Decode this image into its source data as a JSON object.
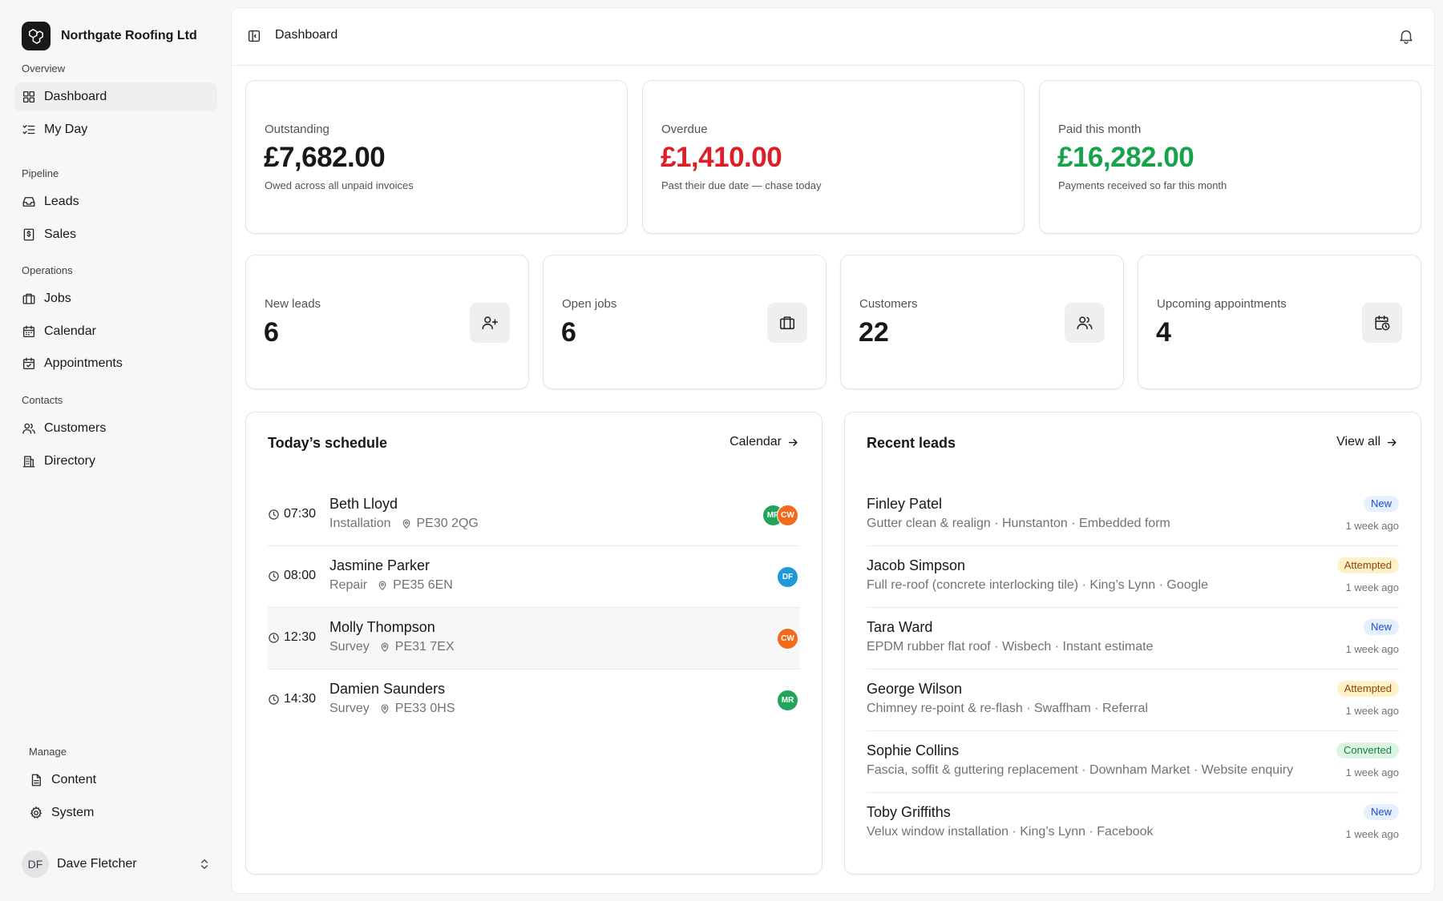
{
  "brand": {
    "name": "Northgate Roofing Ltd"
  },
  "sidebar": {
    "sections": [
      {
        "heading": "Overview",
        "items": [
          {
            "label": "Dashboard",
            "icon": "grid-icon"
          },
          {
            "label": "My Day",
            "icon": "list-check-icon"
          }
        ]
      },
      {
        "heading": "Pipeline",
        "items": [
          {
            "label": "Leads",
            "icon": "inbox-icon"
          },
          {
            "label": "Sales",
            "icon": "receipt-icon"
          }
        ]
      },
      {
        "heading": "Operations",
        "items": [
          {
            "label": "Jobs",
            "icon": "briefcase-icon"
          },
          {
            "label": "Calendar",
            "icon": "calendar-icon"
          },
          {
            "label": "Appointments",
            "icon": "calendar-check-icon"
          }
        ]
      },
      {
        "heading": "Contacts",
        "items": [
          {
            "label": "Customers",
            "icon": "users-icon"
          },
          {
            "label": "Directory",
            "icon": "building-icon"
          }
        ]
      }
    ],
    "manage": {
      "heading": "Manage",
      "items": [
        {
          "label": "Content",
          "icon": "file-icon"
        },
        {
          "label": "System",
          "icon": "gear-icon"
        }
      ]
    },
    "user": {
      "initials": "DF",
      "name": "Dave Fletcher"
    }
  },
  "header": {
    "breadcrumb": "Dashboard"
  },
  "money_cards": [
    {
      "label": "Outstanding",
      "value": "£7,682.00",
      "sub": "Owed across all unpaid invoices",
      "color": "#18181b"
    },
    {
      "label": "Overdue",
      "value": "£1,410.00",
      "sub": "Past their due date — chase today",
      "color": "#dc1f26"
    },
    {
      "label": "Paid this month",
      "value": "£16,282.00",
      "sub": "Payments received so far this month",
      "color": "#16a34a"
    }
  ],
  "stat_cards": [
    {
      "label": "New leads",
      "value": "6",
      "icon": "user-plus-icon"
    },
    {
      "label": "Open jobs",
      "value": "6",
      "icon": "briefcase-icon"
    },
    {
      "label": "Customers",
      "value": "22",
      "icon": "users-icon"
    },
    {
      "label": "Upcoming appointments",
      "value": "4",
      "icon": "calendar-clock-icon"
    }
  ],
  "schedule": {
    "title": "Today’s schedule",
    "link": "Calendar",
    "rows": [
      {
        "time": "07:30",
        "name": "Beth Lloyd",
        "type": "Installation",
        "postcode": "PE30 2QG",
        "assignees": [
          {
            "initials": "MR",
            "color": "#22a55a"
          },
          {
            "initials": "CW",
            "color": "#f26b1d"
          }
        ]
      },
      {
        "time": "08:00",
        "name": "Jasmine Parker",
        "type": "Repair",
        "postcode": "PE35 6EN",
        "assignees": [
          {
            "initials": "DF",
            "color": "#1e9bd7"
          }
        ]
      },
      {
        "time": "12:30",
        "name": "Molly Thompson",
        "type": "Survey",
        "postcode": "PE31 7EX",
        "assignees": [
          {
            "initials": "CW",
            "color": "#f26b1d"
          }
        ]
      },
      {
        "time": "14:30",
        "name": "Damien Saunders",
        "type": "Survey",
        "postcode": "PE33 0HS",
        "assignees": [
          {
            "initials": "MR",
            "color": "#22a55a"
          }
        ]
      }
    ]
  },
  "leads": {
    "title": "Recent leads",
    "link": "View all",
    "rows": [
      {
        "name": "Finley Patel",
        "meta": "Gutter clean & realign · Hunstanton · Embedded form",
        "status": "New",
        "when": "1 week ago"
      },
      {
        "name": "Jacob Simpson",
        "meta": "Full re-roof (concrete interlocking tile) · King’s Lynn · Google",
        "status": "Attempted",
        "when": "1 week ago"
      },
      {
        "name": "Tara Ward",
        "meta": "EPDM rubber flat roof · Wisbech · Instant estimate",
        "status": "New",
        "when": "1 week ago"
      },
      {
        "name": "George Wilson",
        "meta": "Chimney re-point & re-flash · Swaffham · Referral",
        "status": "Attempted",
        "when": "1 week ago"
      },
      {
        "name": "Sophie Collins",
        "meta": "Fascia, soffit & guttering replacement · Downham Market · Website enquiry",
        "status": "Converted",
        "when": "1 week ago"
      },
      {
        "name": "Toby Griffiths",
        "meta": "Velux window installation · King’s Lynn · Facebook",
        "status": "New",
        "when": "1 week ago"
      }
    ]
  }
}
